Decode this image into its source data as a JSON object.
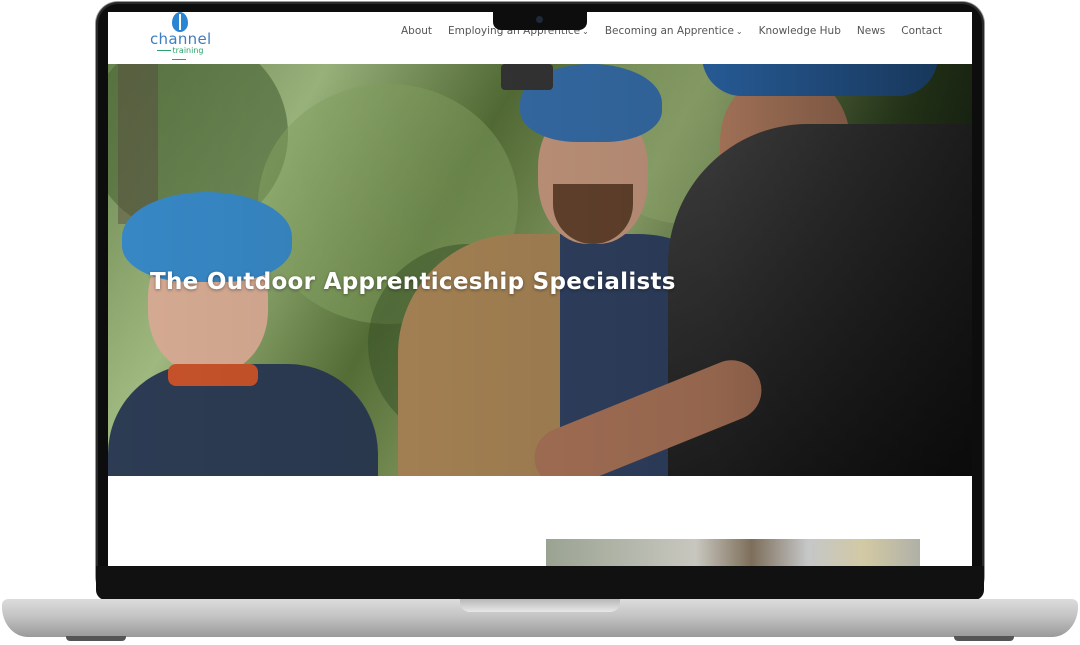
{
  "brand": {
    "logo_word": "channel",
    "logo_sub": "training"
  },
  "nav": {
    "items": [
      {
        "label": "About",
        "has_dropdown": false
      },
      {
        "label": "Employing an Apprentice",
        "has_dropdown": true
      },
      {
        "label": "Becoming an Apprentice",
        "has_dropdown": true
      },
      {
        "label": "Knowledge Hub",
        "has_dropdown": false
      },
      {
        "label": "News",
        "has_dropdown": false
      },
      {
        "label": "Contact",
        "has_dropdown": false
      }
    ],
    "dropdown_glyph": "⌄"
  },
  "hero": {
    "heading": "The Outdoor Apprenticeship Specialists"
  },
  "colors": {
    "brand_blue": "#3d7ec2",
    "brand_green": "#2aa36a",
    "nav_text": "#555555"
  }
}
